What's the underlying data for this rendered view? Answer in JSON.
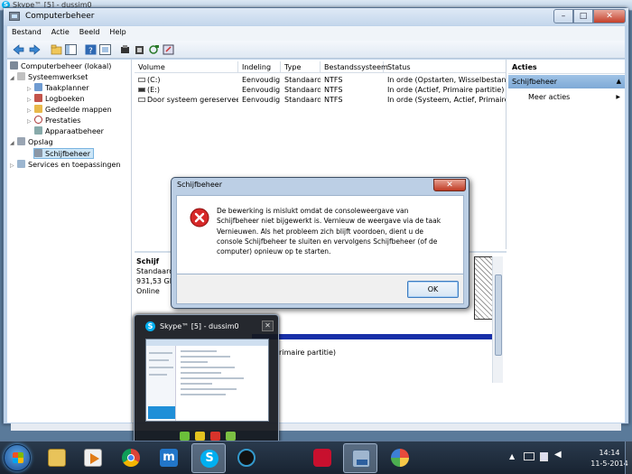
{
  "background_window": {
    "title": "Skype™ [5] - dussim0",
    "icon": "skype-icon"
  },
  "window": {
    "title": "Computerbeheer",
    "icon": "computer-management-icon",
    "minimize": "–",
    "maximize": "□",
    "close": "✕"
  },
  "menubar": {
    "items": [
      "Bestand",
      "Actie",
      "Beeld",
      "Help"
    ]
  },
  "toolbar": {
    "icons": [
      "back-arrow-icon",
      "forward-arrow-icon",
      "up-folder-icon",
      "show-hide-tree-icon",
      "help-icon",
      "properties-icon",
      "connect-icon",
      "delete-icon",
      "refresh-icon",
      "export-icon"
    ]
  },
  "tree": {
    "root": "Computerbeheer (lokaal)",
    "system": "Systeemwerkset",
    "task_scheduler": "Taakplanner",
    "event_viewer": "Logboeken",
    "shared_folders": "Gedeelde mappen",
    "performance": "Prestaties",
    "device_manager": "Apparaatbeheer",
    "storage": "Opslag",
    "disk_mgmt": "Schijfbeheer",
    "services": "Services en toepassingen"
  },
  "volume_table": {
    "columns": [
      "Volume",
      "Indeling",
      "Type",
      "Bestandssysteem",
      "Status"
    ],
    "rows": [
      [
        "(C:)",
        "Eenvoudig",
        "Standaard",
        "NTFS",
        "In orde (Opstarten, Wisselbestand, C"
      ],
      [
        "(E:)",
        "Eenvoudig",
        "Standaard",
        "NTFS",
        "In orde (Actief, Primaire partitie)"
      ],
      [
        "Door systeem gereserveerd",
        "Eenvoudig",
        "Standaard",
        "NTFS",
        "In orde (Systeem, Actief, Primaire pa"
      ]
    ]
  },
  "disk_pane": {
    "disk_label": "Schijf",
    "disk_type": "Standaard",
    "disk_size": "931,53 GB",
    "disk_status": "Online",
    "partition_fragment": "rimaire partitie)"
  },
  "actions": {
    "header": "Acties",
    "section": "Schijfbeheer",
    "section_arrow": "▲",
    "more": "Meer acties",
    "more_arrow": "▶"
  },
  "dialog": {
    "title": "Schijfbeheer",
    "close": "✕",
    "message": "De bewerking is mislukt omdat de consoleweergave van Schijfbeheer niet bijgewerkt is. Vernieuw de weergave via de taak Vernieuwen. Als het probleem zich blijft voordoen, dient u de console Schijfbeheer te sluiten en vervolgens Schijfbeheer (of de computer) opnieuw op te starten.",
    "ok": "OK",
    "icon": "error-icon"
  },
  "thumbnail": {
    "title": "Skype™ [5] - dussim0",
    "close": "✕"
  },
  "taskbar": {
    "apps": [
      "explorer-icon",
      "media-player-icon",
      "chrome-icon",
      "maxthon-icon",
      "skype-icon",
      "bitdefender-icon",
      "ccleaner-icon",
      "network-icon",
      "paint-icon"
    ],
    "time": "14:14",
    "date": "11-5-2014"
  },
  "colors": {
    "accent": "#1f8fd8",
    "error": "#d62828",
    "selection": "#cde6f7",
    "taskbar": "#1f2c3c"
  }
}
